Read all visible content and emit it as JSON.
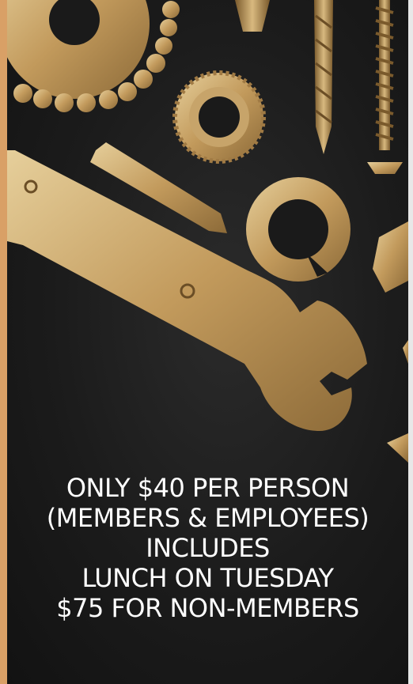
{
  "promo": {
    "lines": [
      "ONLY $40 PER PERSON",
      "(MEMBERS & EMPLOYEES)",
      "INCLUDES",
      "LUNCH ON TUESDAY",
      "$75 FOR NON-MEMBERS"
    ]
  },
  "colors": {
    "background": "#1b1b1b",
    "accent_strip": "#d9a066",
    "gold": "#c7a46a",
    "text": "#ffffff"
  },
  "icons": [
    "washer-icon",
    "bearing-chain-icon",
    "flange-nut-icon",
    "drill-bit-icon",
    "screw-icon",
    "wrench-icon",
    "hex-bit-icon",
    "split-ring-washer-icon",
    "bolt-icon"
  ]
}
